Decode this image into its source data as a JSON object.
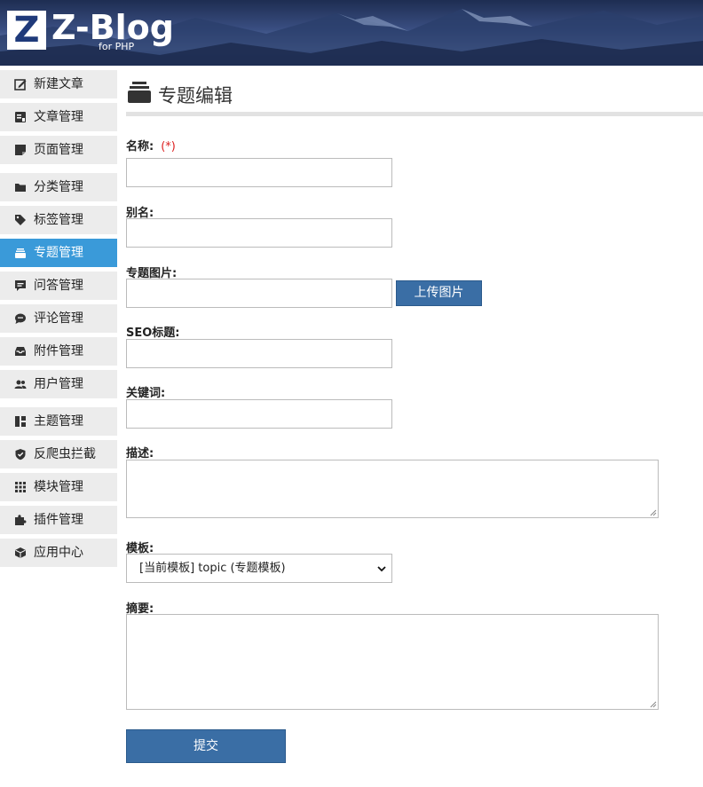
{
  "brand": {
    "logo_letter": "Z",
    "name": "Z-Blog",
    "tagline": "for PHP"
  },
  "sidebar": {
    "items": [
      {
        "label": "新建文章",
        "icon": "pencil-square-icon"
      },
      {
        "label": "文章管理",
        "icon": "article-list-icon"
      },
      {
        "label": "页面管理",
        "icon": "page-icon"
      },
      {
        "label": "分类管理",
        "icon": "folder-icon"
      },
      {
        "label": "标签管理",
        "icon": "tag-icon"
      },
      {
        "label": "专题管理",
        "icon": "stack-icon",
        "active": true
      },
      {
        "label": "问答管理",
        "icon": "chat-bubble-icon"
      },
      {
        "label": "评论管理",
        "icon": "comment-icon"
      },
      {
        "label": "附件管理",
        "icon": "inbox-icon"
      },
      {
        "label": "用户管理",
        "icon": "users-icon"
      },
      {
        "label": "主题管理",
        "icon": "layout-icon"
      },
      {
        "label": "反爬虫拦截",
        "icon": "shield-icon"
      },
      {
        "label": "模块管理",
        "icon": "grid-icon"
      },
      {
        "label": "插件管理",
        "icon": "puzzle-icon"
      },
      {
        "label": "应用中心",
        "icon": "box-icon"
      }
    ]
  },
  "page": {
    "title": "专题编辑"
  },
  "form": {
    "name_label": "名称:",
    "required_mark": "(*)",
    "alias_label": "别名:",
    "image_label": "专题图片:",
    "upload_button": "上传图片",
    "seo_title_label": "SEO标题:",
    "keywords_label": "关键词:",
    "description_label": "描述:",
    "template_label": "模板:",
    "template_selected": "[当前模板] topic (专题模板)",
    "summary_label": "摘要:",
    "submit_button": "提交"
  },
  "colors": {
    "active_nav": "#3a9ad9",
    "button": "#3a6ea5",
    "required": "#dd2222"
  }
}
